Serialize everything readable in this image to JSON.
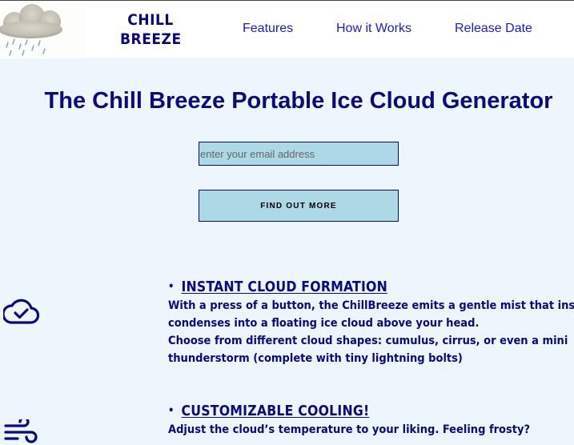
{
  "header": {
    "brand_line1": "CHILL",
    "brand_line2": "BREEZE",
    "nav": [
      {
        "label": "Features"
      },
      {
        "label": "How it Works"
      },
      {
        "label": "Release Date"
      }
    ]
  },
  "hero": {
    "title": "The Chill Breeze Portable Ice Cloud Generator",
    "email_placeholder": "enter your email address",
    "button_label": "FIND OUT MORE"
  },
  "features": [
    {
      "icon": "cloud-check-icon",
      "bullet": "•",
      "title": "INSTANT CLOUD FORMATION",
      "lines": [
        "With a press of a button, the ChillBreeze emits a gentle mist that inst",
        "condenses into a floating ice cloud above your head.",
        "Choose from different cloud shapes: cumulus, cirrus, or even a mini",
        "thunderstorm (complete with tiny lightning bolts)"
      ]
    },
    {
      "icon": "wind-icon",
      "bullet": "•",
      "title": "CUSTOMIZABLE COOLING!",
      "lines": [
        "Adjust the cloud’s temperature to your liking. Feeling frosty?"
      ]
    }
  ],
  "colors": {
    "page_background": "#ecf6fc",
    "brand_text": "#08087a",
    "nav_link": "#1a1ad6",
    "heading": "#0a0a80",
    "input_background": "#add8e6"
  }
}
